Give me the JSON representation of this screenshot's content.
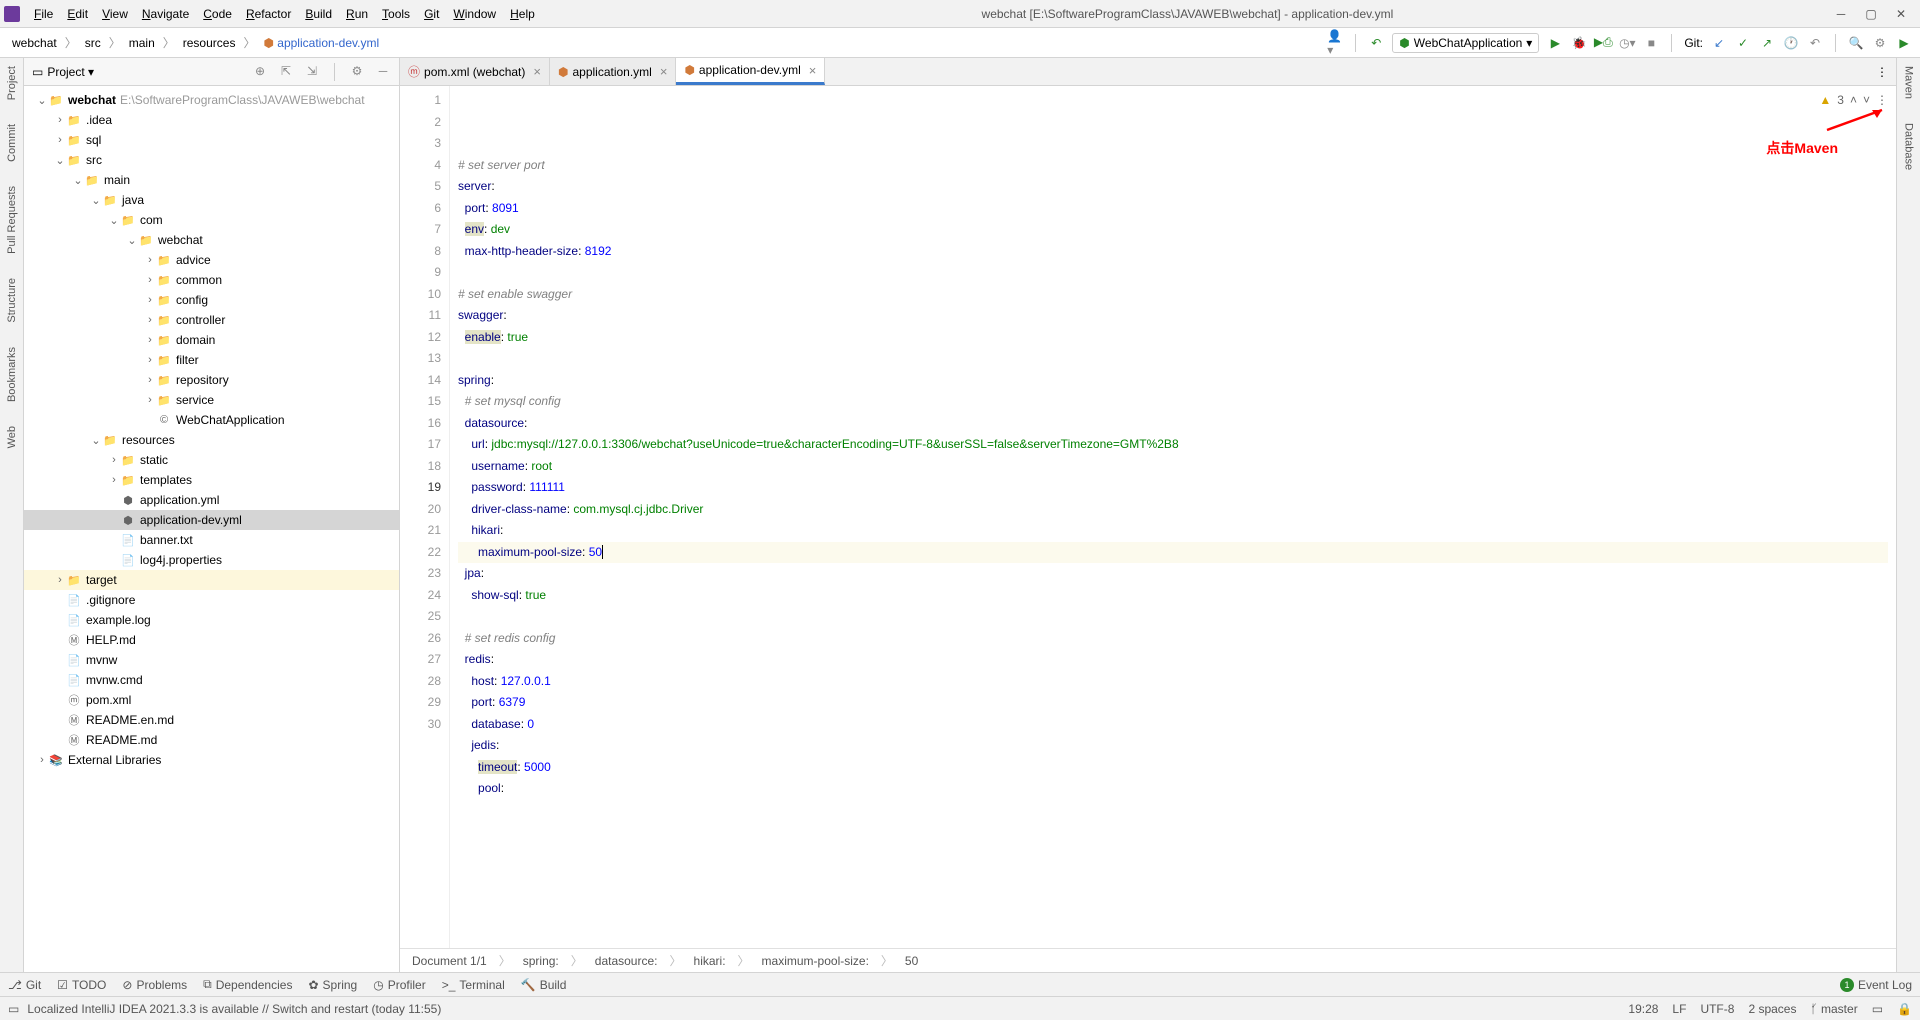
{
  "window_title": "webchat [E:\\SoftwareProgramClass\\JAVAWEB\\webchat] - application-dev.yml",
  "menubar": [
    "File",
    "Edit",
    "View",
    "Navigate",
    "Code",
    "Refactor",
    "Build",
    "Run",
    "Tools",
    "Git",
    "Window",
    "Help"
  ],
  "breadcrumb": [
    "webchat",
    "src",
    "main",
    "resources",
    "application-dev.yml"
  ],
  "run_config": "WebChatApplication",
  "git_label": "Git:",
  "left_gutter": [
    "Project",
    "Commit",
    "Pull Requests",
    "Structure",
    "Bookmarks",
    "Web"
  ],
  "right_gutter": [
    "Maven",
    "Database"
  ],
  "project_panel": {
    "title": "Project"
  },
  "tree": [
    {
      "d": 0,
      "icon": "folder-blue",
      "label": "webchat",
      "hint": "E:\\SoftwareProgramClass\\JAVAWEB\\webchat",
      "chev": "v",
      "bold": true
    },
    {
      "d": 1,
      "icon": "folder",
      "label": ".idea",
      "chev": ">"
    },
    {
      "d": 1,
      "icon": "folder",
      "label": "sql",
      "chev": ">"
    },
    {
      "d": 1,
      "icon": "folder-blue",
      "label": "src",
      "chev": "v"
    },
    {
      "d": 2,
      "icon": "folder-blue",
      "label": "main",
      "chev": "v"
    },
    {
      "d": 3,
      "icon": "folder-blue",
      "label": "java",
      "chev": "v"
    },
    {
      "d": 4,
      "icon": "folder",
      "label": "com",
      "chev": "v"
    },
    {
      "d": 5,
      "icon": "folder",
      "label": "webchat",
      "chev": "v"
    },
    {
      "d": 6,
      "icon": "folder",
      "label": "advice",
      "chev": ">"
    },
    {
      "d": 6,
      "icon": "folder",
      "label": "common",
      "chev": ">"
    },
    {
      "d": 6,
      "icon": "folder",
      "label": "config",
      "chev": ">"
    },
    {
      "d": 6,
      "icon": "folder",
      "label": "controller",
      "chev": ">"
    },
    {
      "d": 6,
      "icon": "folder",
      "label": "domain",
      "chev": ">"
    },
    {
      "d": 6,
      "icon": "folder",
      "label": "filter",
      "chev": ">"
    },
    {
      "d": 6,
      "icon": "folder",
      "label": "repository",
      "chev": ">"
    },
    {
      "d": 6,
      "icon": "folder",
      "label": "service",
      "chev": ">"
    },
    {
      "d": 6,
      "icon": "class",
      "label": "WebChatApplication"
    },
    {
      "d": 3,
      "icon": "folder-res",
      "label": "resources",
      "chev": "v"
    },
    {
      "d": 4,
      "icon": "folder",
      "label": "static",
      "chev": ">"
    },
    {
      "d": 4,
      "icon": "folder",
      "label": "templates",
      "chev": ">"
    },
    {
      "d": 4,
      "icon": "yml",
      "label": "application.yml"
    },
    {
      "d": 4,
      "icon": "yml",
      "label": "application-dev.yml",
      "selected": true
    },
    {
      "d": 4,
      "icon": "txt",
      "label": "banner.txt"
    },
    {
      "d": 4,
      "icon": "prop",
      "label": "log4j.properties"
    },
    {
      "d": 1,
      "icon": "folder-ex",
      "label": "target",
      "chev": ">",
      "hl": true
    },
    {
      "d": 1,
      "icon": "txt",
      "label": ".gitignore"
    },
    {
      "d": 1,
      "icon": "txt",
      "label": "example.log"
    },
    {
      "d": 1,
      "icon": "md",
      "label": "HELP.md"
    },
    {
      "d": 1,
      "icon": "sh",
      "label": "mvnw"
    },
    {
      "d": 1,
      "icon": "cmd",
      "label": "mvnw.cmd"
    },
    {
      "d": 1,
      "icon": "maven",
      "label": "pom.xml"
    },
    {
      "d": 1,
      "icon": "md",
      "label": "README.en.md"
    },
    {
      "d": 1,
      "icon": "md",
      "label": "README.md"
    },
    {
      "d": 0,
      "icon": "lib",
      "label": "External Libraries",
      "chev": ">"
    }
  ],
  "tabs": [
    {
      "icon": "maven",
      "label": "pom.xml (webchat)"
    },
    {
      "icon": "yml",
      "label": "application.yml"
    },
    {
      "icon": "yml",
      "label": "application-dev.yml",
      "active": true
    }
  ],
  "inspections_count": "3",
  "code_lines": [
    {
      "n": 1,
      "t": "comment",
      "text": "# set server port"
    },
    {
      "n": 2,
      "html": "<span class='key'>server</span>:"
    },
    {
      "n": 3,
      "html": "  <span class='key'>port</span>: <span class='val-num'>8091</span>"
    },
    {
      "n": 4,
      "html": "  <span class='key hl'>env</span>: <span class='val-str'>dev</span>"
    },
    {
      "n": 5,
      "html": "  <span class='key'>max-http-header-size</span>: <span class='val-num'>8192</span>"
    },
    {
      "n": 6,
      "html": ""
    },
    {
      "n": 7,
      "t": "comment",
      "text": "# set enable swagger"
    },
    {
      "n": 8,
      "html": "<span class='key'>swagger</span>:"
    },
    {
      "n": 9,
      "html": "  <span class='key hl'>enable</span>: <span class='val-str'>true</span>"
    },
    {
      "n": 10,
      "html": ""
    },
    {
      "n": 11,
      "html": "<span class='key'>spring</span>:"
    },
    {
      "n": 12,
      "t": "comment",
      "text": "  # set mysql config"
    },
    {
      "n": 13,
      "html": "  <span class='key'>datasource</span>:"
    },
    {
      "n": 14,
      "html": "    <span class='key'>url</span>: <span class='val-str'>jdbc:mysql://127.0.0.1:3306/webchat?useUnicode=true&amp;characterEncoding=UTF-8&amp;userSSL=false&amp;serverTimezone=GMT%2B8</span>"
    },
    {
      "n": 15,
      "html": "    <span class='key'>username</span>: <span class='val-str'>root</span>"
    },
    {
      "n": 16,
      "html": "    <span class='key'>password</span>: <span class='val-num'>111111</span>"
    },
    {
      "n": 17,
      "html": "    <span class='key'>driver-class-name</span>: <span class='val-str'>com.mysql.cj.jdbc.Driver</span>"
    },
    {
      "n": 18,
      "html": "    <span class='key'>hikari</span>:"
    },
    {
      "n": 19,
      "active": true,
      "html": "      <span class='key'>maximum-pool-size</span>: <span class='val-num'>50</span><span class='cursor'></span>"
    },
    {
      "n": 20,
      "html": "  <span class='key'>jpa</span>:"
    },
    {
      "n": 21,
      "html": "    <span class='key'>show-sql</span>: <span class='val-str'>true</span>"
    },
    {
      "n": 22,
      "html": ""
    },
    {
      "n": 23,
      "t": "comment",
      "text": "  # set redis config"
    },
    {
      "n": 24,
      "html": "  <span class='key'>redis</span>:"
    },
    {
      "n": 25,
      "html": "    <span class='key'>host</span>: <span class='val-num'>127.0.0.1</span>"
    },
    {
      "n": 26,
      "html": "    <span class='key'>port</span>: <span class='val-num'>6379</span>"
    },
    {
      "n": 27,
      "html": "    <span class='key'>database</span>: <span class='val-num'>0</span>"
    },
    {
      "n": 28,
      "html": "    <span class='key'>jedis</span>:"
    },
    {
      "n": 29,
      "html": "      <span class='key hl'>timeout</span>: <span class='val-num'>5000</span>"
    },
    {
      "n": 30,
      "html": "      <span class='key'>pool</span>:"
    }
  ],
  "annotation": "点击Maven",
  "crumb_bottom": [
    "Document 1/1",
    "spring:",
    "datasource:",
    "hikari:",
    "maximum-pool-size:",
    "50"
  ],
  "bottom_bar": [
    "Git",
    "TODO",
    "Problems",
    "Dependencies",
    "Spring",
    "Profiler",
    "Terminal",
    "Build"
  ],
  "event_log": "Event Log",
  "status_msg": "Localized IntelliJ IDEA 2021.3.3 is available // Switch and restart (today 11:55)",
  "status_right": {
    "pos": "19:28",
    "lf": "LF",
    "enc": "UTF-8",
    "indent": "2 spaces",
    "branch": "master"
  }
}
